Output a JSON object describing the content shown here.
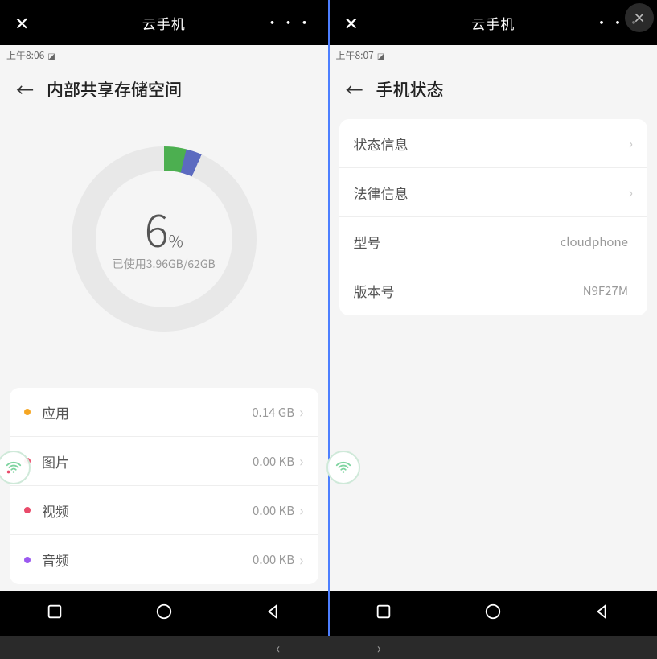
{
  "close_overlay": true,
  "left": {
    "topbar": {
      "title": "云手机"
    },
    "status_time": "上午8:06",
    "page_title": "内部共享存储空间",
    "donut": {
      "percent": "6",
      "percent_symbol": "%",
      "subtitle": "已使用3.96GB/62GB"
    },
    "categories": [
      {
        "color": "#f5a623",
        "label": "应用",
        "value": "0.14 GB"
      },
      {
        "color": "#e94b6a",
        "label": "图片",
        "value": "0.00 KB"
      },
      {
        "color": "#e94b6a",
        "label": "视频",
        "value": "0.00 KB"
      },
      {
        "color": "#9b59f0",
        "label": "音频",
        "value": "0.00 KB"
      }
    ]
  },
  "right": {
    "topbar": {
      "title": "云手机"
    },
    "status_time": "上午8:07",
    "page_title": "手机状态",
    "rows": [
      {
        "label": "状态信息",
        "value": "",
        "chevron": true
      },
      {
        "label": "法律信息",
        "value": "",
        "chevron": true
      },
      {
        "label": "型号",
        "value": "cloudphone",
        "chevron": false
      },
      {
        "label": "版本号",
        "value": "N9F27M",
        "chevron": false
      }
    ]
  }
}
